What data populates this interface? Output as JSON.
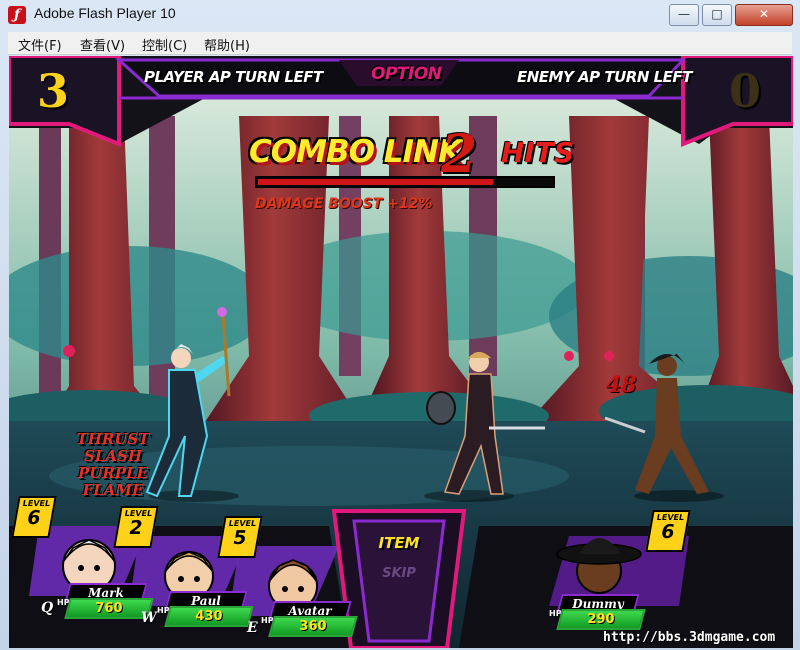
{
  "window": {
    "title": "Adobe Flash Player 10",
    "controls": {
      "minimize": "—",
      "maximize": "□",
      "close": "✕"
    }
  },
  "menubar": [
    "文件(F)",
    "查看(V)",
    "控制(C)",
    "帮助(H)"
  ],
  "hud": {
    "player_ap": "3",
    "player_ap_label": "PLAYER AP TURN LEFT",
    "option_label": "OPTION",
    "enemy_ap_label": "ENEMY AP TURN LEFT",
    "enemy_ap": "0"
  },
  "combo": {
    "label": "COMBO LINK",
    "count": "2",
    "hits_label": "HITS",
    "boost": "DAMAGE BOOST +12%",
    "bar_fill": 0.8
  },
  "skills": [
    "THRUST",
    "SLASH",
    "PURPLE FLAME"
  ],
  "damage_popup": "48",
  "party": [
    {
      "name": "Mark",
      "level_label": "LEVEL",
      "level": "6",
      "hp_label": "HP",
      "hp": "760",
      "hotkey": "Q",
      "hair": "#e8e8ee",
      "skin": "#f3d6bd"
    },
    {
      "name": "Paul",
      "level_label": "LEVEL",
      "level": "2",
      "hp_label": "HP",
      "hp": "430",
      "hotkey": "W",
      "hair": "#d9a95a",
      "skin": "#f2cfaa"
    },
    {
      "name": "Avatar",
      "level_label": "LEVEL",
      "level": "5",
      "hp_label": "HP",
      "hp": "360",
      "hotkey": "E",
      "hair": "#8a4f2b",
      "skin": "#f0c9a3"
    }
  ],
  "enemy": {
    "name": "Dummy",
    "level_label": "LEVEL",
    "level": "6",
    "hp_label": "HP",
    "hp": "290",
    "hair": "#1a1a1a",
    "skin": "#6b3d20"
  },
  "action_menu": {
    "item": "ITEM",
    "skip": "SKIP"
  },
  "watermark": "http://bbs.3dmgame.com",
  "colors": {
    "accent_purple": "#8a2bd0",
    "accent_pink": "#e0197a",
    "ap_yellow": "#ffd21a",
    "hp_green": "#2ba23a"
  }
}
